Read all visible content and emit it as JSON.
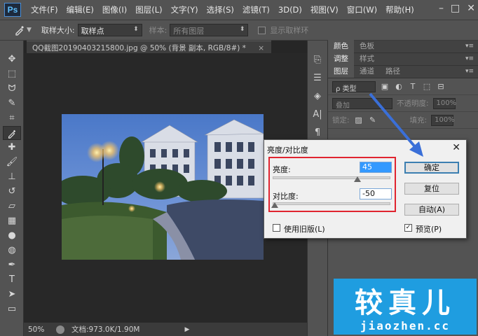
{
  "app": {
    "logo": "Ps",
    "menu": [
      "文件(F)",
      "编辑(E)",
      "图像(I)",
      "图层(L)",
      "文字(Y)",
      "选择(S)",
      "滤镜(T)",
      "3D(D)",
      "视图(V)",
      "窗口(W)",
      "帮助(H)"
    ],
    "window_controls": [
      "–",
      "□",
      "✕"
    ]
  },
  "options": {
    "sample_size_label": "取样大小:",
    "sample_size_value": "取样点",
    "sample_label": "样本:",
    "sample_value": "所有图层",
    "show_ring_label": "显示取样环"
  },
  "tools": [
    "move-icon",
    "marquee-icon",
    "lasso-icon",
    "quick-select-icon",
    "crop-icon",
    "eyedropper-icon",
    "healing-icon",
    "brush-icon",
    "stamp-icon",
    "history-brush-icon",
    "eraser-icon",
    "gradient-icon",
    "blur-icon",
    "dodge-icon",
    "pen-icon",
    "type-icon",
    "path-select-icon",
    "shape-icon"
  ],
  "document": {
    "tab_title": "QQ截图20190403215800.jpg @ 50% (背景 副本, RGB/8#) *",
    "close": "×"
  },
  "status": {
    "zoom": "50%",
    "doc_info": "文档:973.0K/1.90M"
  },
  "panels": {
    "tabs_row1": [
      "颜色",
      "色板"
    ],
    "tabs_row2": [
      "调整",
      "样式"
    ],
    "tabs_row3": [
      "图层",
      "通道",
      "路径"
    ],
    "filter_kind": "ρ 类型",
    "blend_mode": "叠加",
    "opacity_label": "不透明度:",
    "opacity_value": "100%",
    "lock_label": "锁定:",
    "fill_label": "填充:",
    "fill_value": "100%"
  },
  "dialog": {
    "title": "亮度/对比度",
    "close": "✕",
    "brightness_label": "亮度:",
    "brightness_value": "45",
    "contrast_label": "对比度:",
    "contrast_value": "-50",
    "ok_label": "确定",
    "reset_label": "复位",
    "auto_label": "自动(A)",
    "legacy_label": "使用旧版(L)",
    "preview_label": "预览(P)",
    "preview_checked": "✓",
    "brightness_level": 0.72,
    "contrast_level": 0.0
  },
  "watermark": {
    "main": "较真儿",
    "sub": "jiaozhen.cc"
  },
  "colors": {
    "annotation_red": "#e0242f",
    "annotation_blue": "#3a6fd8",
    "watermark_bg": "#1f9de0"
  }
}
